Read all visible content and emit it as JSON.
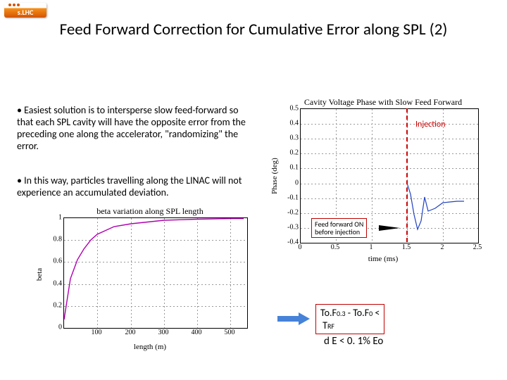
{
  "logo": {
    "text": "s.LHC"
  },
  "title": "Feed Forward Correction for Cumulative Error along SPL (2)",
  "bullets": {
    "b1": "• Easiest solution is to intersperse slow feed-forward so that each SPL cavity will have the opposite error from the preceding one along the accelerator, \"randomizing\" the error.",
    "b2": "• In this way, particles travelling along the LINAC will not experience an accumulated deviation."
  },
  "phase_chart": {
    "title": "Cavity Voltage Phase with Slow Feed Forward",
    "ylabel": "Phase (deg)",
    "xlabel": "time (ms)",
    "injection_label": "Injection",
    "ff_box_l1": "Feed forward ON",
    "ff_box_l2": "before injection",
    "yticks": [
      "0.5",
      "0.4",
      "0.3",
      "0.2",
      "0.1",
      "0",
      "-0.1",
      "-0.2",
      "-0.3",
      "-0.4"
    ],
    "xticks": [
      "0",
      "0.5",
      "1",
      "1.5",
      "2",
      "2.5"
    ]
  },
  "beta_chart": {
    "title": "beta variation along SPL length",
    "ylabel": "beta",
    "xlabel": "length (m)",
    "yticks": [
      "1",
      "0.8",
      "0.6",
      "0.4",
      "0.2",
      "0"
    ],
    "xticks": [
      "100",
      "200",
      "300",
      "400",
      "500"
    ]
  },
  "eq": {
    "line1_a": "To.F",
    "line1_sub1": "0.3",
    "line1_b": " - To.F",
    "line1_sub2": "0",
    "line1_c": " <",
    "line2_a": "T",
    "line2_sub": "RF",
    "line3": "d E  <  0. 1% Eo"
  },
  "chart_data": [
    {
      "type": "line",
      "title": "beta variation along SPL length",
      "xlabel": "length (m)",
      "ylabel": "beta",
      "xlim": [
        0,
        550
      ],
      "ylim": [
        0,
        1.05
      ],
      "series": [
        {
          "name": "beta",
          "color": "#b000b0",
          "x": [
            0,
            20,
            40,
            60,
            80,
            100,
            150,
            200,
            300,
            400,
            500,
            540
          ],
          "y": [
            0.08,
            0.45,
            0.62,
            0.72,
            0.8,
            0.85,
            0.92,
            0.95,
            0.98,
            0.99,
            1.0,
            1.0
          ]
        }
      ]
    },
    {
      "type": "line",
      "title": "Cavity Voltage Phase with Slow Feed Forward",
      "xlabel": "time (ms)",
      "ylabel": "Phase (deg)",
      "xlim": [
        0,
        2.5
      ],
      "ylim": [
        -0.45,
        0.5
      ],
      "annotations": [
        {
          "label": "Injection",
          "x": 1.5
        },
        {
          "label": "Feed forward ON before injection",
          "x_range": [
            0,
            1.5
          ]
        }
      ],
      "series": [
        {
          "name": "phase",
          "color": "#2040c0",
          "x": [
            1.5,
            1.55,
            1.6,
            1.65,
            1.7,
            1.75,
            1.8,
            1.9,
            2.0,
            2.1,
            2.2,
            2.3
          ],
          "y": [
            0.0,
            -0.08,
            -0.23,
            -0.33,
            -0.27,
            -0.1,
            -0.2,
            -0.18,
            -0.14,
            -0.13,
            -0.13,
            -0.13
          ]
        }
      ]
    }
  ]
}
